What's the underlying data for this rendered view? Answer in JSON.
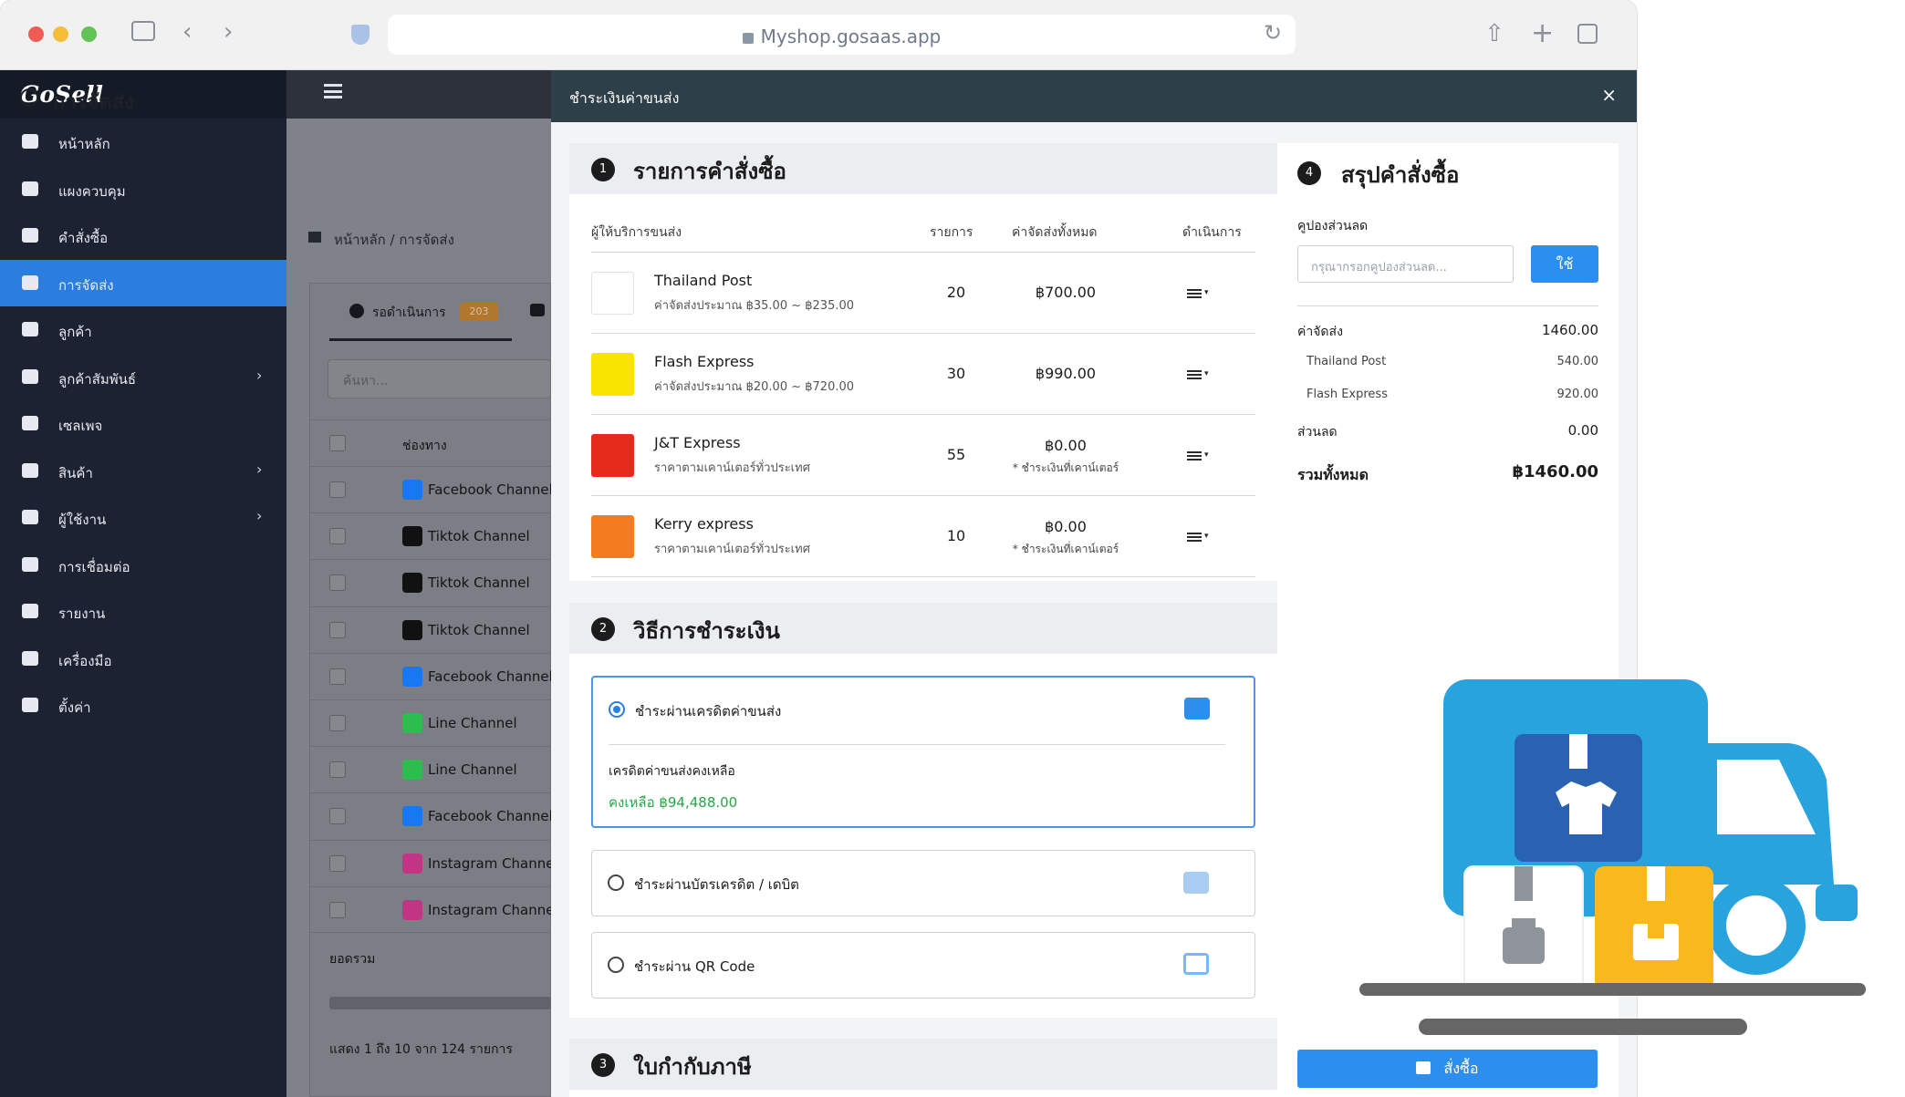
{
  "browser": {
    "url": "Myshop.gosaas.app"
  },
  "sidebar": {
    "logo": "GoSell",
    "items": [
      {
        "label": "หน้าหลัก",
        "icon": "home-icon"
      },
      {
        "label": "แผงควบคุม",
        "icon": "dashboard-icon"
      },
      {
        "label": "คำสั่งซื้อ",
        "icon": "cart-icon"
      },
      {
        "label": "การจัดส่ง",
        "icon": "truck-icon",
        "active": true
      },
      {
        "label": "ลูกค้า",
        "icon": "users-icon"
      },
      {
        "label": "ลูกค้าสัมพันธ์",
        "icon": "user-tie-icon",
        "chevron": true
      },
      {
        "label": "เซลเพจ",
        "icon": "window-icon"
      },
      {
        "label": "สินค้า",
        "icon": "boxes-icon",
        "chevron": true
      },
      {
        "label": "ผู้ใช้งาน",
        "icon": "user-group-icon",
        "chevron": true
      },
      {
        "label": "การเชื่อมต่อ",
        "icon": "plug-icon"
      },
      {
        "label": "รายงาน",
        "icon": "chart-icon"
      },
      {
        "label": "เครื่องมือ",
        "icon": "tools-icon"
      },
      {
        "label": "ตั้งค่า",
        "icon": "gear-icon"
      }
    ]
  },
  "background_page": {
    "title": "การจัดส่ง",
    "breadcrumb": "หน้าหลัก  /  การจัดส่ง",
    "tab_label": "รอดำเนินการ",
    "tab_badge": "203",
    "search_placeholder": "ค้นหา...",
    "column_channel": "ช่องทาง",
    "rows": [
      {
        "channel": "Facebook Channel",
        "kind": "facebook"
      },
      {
        "channel": "Tiktok Channel",
        "kind": "tiktok"
      },
      {
        "channel": "Tiktok Channel",
        "kind": "tiktok"
      },
      {
        "channel": "Tiktok Channel",
        "kind": "tiktok"
      },
      {
        "channel": "Facebook Channel",
        "kind": "facebook"
      },
      {
        "channel": "Line Channel",
        "kind": "line"
      },
      {
        "channel": "Line Channel",
        "kind": "line"
      },
      {
        "channel": "Facebook Channel",
        "kind": "facebook"
      },
      {
        "channel": "Instagram Channel",
        "kind": "instagram"
      },
      {
        "channel": "Instagram Channel",
        "kind": "instagram"
      }
    ],
    "total_label": "ยอดรวม",
    "showing": "แสดง 1 ถึง 10 จาก 124 รายการ"
  },
  "modal": {
    "title": "ชำระเงินค่าขนส่ง",
    "close": "×",
    "section1": {
      "step": "1",
      "title": "รายการคำสั่งซื้อ",
      "headers": {
        "provider": "ผู้ให้บริการขนส่ง",
        "items": "รายการ",
        "fee": "ค่าจัดส่งทั้งหมด",
        "action": "ดำเนินการ"
      },
      "carriers": [
        {
          "name": "Thailand Post",
          "desc": "ค่าจัดส่งประมาณ ฿35.00 ~ ฿235.00",
          "qty": "20",
          "fee": "฿700.00",
          "note": "",
          "color": "#ffffff"
        },
        {
          "name": "Flash Express",
          "desc": "ค่าจัดส่งประมาณ ฿20.00 ~ ฿720.00",
          "qty": "30",
          "fee": "฿990.00",
          "note": "",
          "color": "#f8e400"
        },
        {
          "name": "J&T Express",
          "desc": "ราคาตามเคาน์เตอร์ทั่วประเทศ",
          "qty": "55",
          "fee": "฿0.00",
          "note": "* ชำระเงินที่เคาน์เตอร์",
          "color": "#e62a1c"
        },
        {
          "name": "Kerry express",
          "desc": "ราคาตามเคาน์เตอร์ทั่วประเทศ",
          "qty": "10",
          "fee": "฿0.00",
          "note": "* ชำระเงินที่เคาน์เตอร์",
          "color": "#f47b20"
        }
      ]
    },
    "section2": {
      "step": "2",
      "title": "วิธีการชำระเงิน",
      "options": [
        {
          "label": "ชำระผ่านเครดิตค่าขนส่ง",
          "selected": true
        },
        {
          "label": "ชำระผ่านบัตรเครดิต / เดบิต",
          "selected": false
        },
        {
          "label": "ชำระผ่าน QR Code",
          "selected": false
        }
      ],
      "credit_title": "เครดิตค่าขนส่งคงเหลือ",
      "credit_balance": "คงเหลือ ฿94,488.00"
    },
    "section3": {
      "step": "3",
      "title": "ใบกำกับภาษี"
    },
    "summary": {
      "step": "4",
      "title": "สรุปคำสั่งซื้อ",
      "coupon_label": "คูปองส่วนลด",
      "coupon_placeholder": "กรุณากรอกคูปองส่วนลด...",
      "apply": "ใช้",
      "shipping_label": "ค่าจัดส่ง",
      "shipping_value": "1460.00",
      "lines": [
        {
          "label": "Thailand Post",
          "value": "540.00"
        },
        {
          "label": "Flash Express",
          "value": "920.00"
        }
      ],
      "discount_label": "ส่วนลด",
      "discount_value": "0.00",
      "total_label": "รวมทั้งหมด",
      "total_value": "฿1460.00",
      "order_button": "สั่งซื้อ"
    }
  },
  "colors": {
    "accent": "#2c8ff0",
    "sidebar": "#1c2232",
    "active": "#2c7de0",
    "truck": "#29a3dd",
    "box_blue": "#2962b0",
    "box_yellow": "#f9b91c"
  }
}
